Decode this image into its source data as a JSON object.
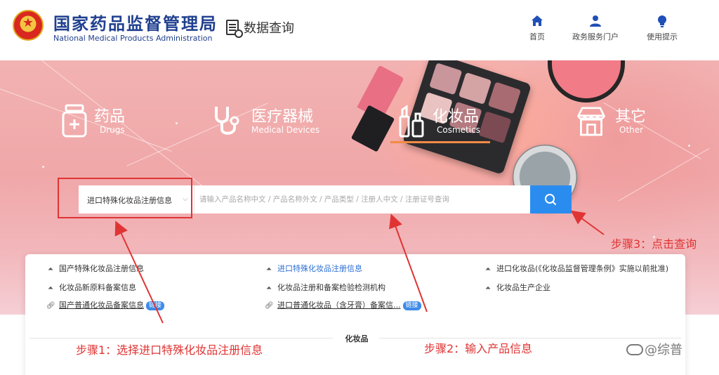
{
  "header": {
    "org_name_cn": "国家药品监督管理局",
    "org_name_en": "National Medical Products Administration",
    "data_query_label": "数据查询",
    "nav": [
      {
        "label": "首页",
        "icon": "home-icon"
      },
      {
        "label": "政务服务门户",
        "icon": "user-icon"
      },
      {
        "label": "使用提示",
        "icon": "lightbulb-icon"
      }
    ]
  },
  "categories": [
    {
      "cn": "药品",
      "en": "Drugs",
      "icon": "pill-bottle-icon"
    },
    {
      "cn": "医疗器械",
      "en": "Medical Devices",
      "icon": "stethoscope-icon"
    },
    {
      "cn": "化妆品",
      "en": "Cosmetics",
      "icon": "cosmetics-icon"
    },
    {
      "cn": "其它",
      "en": "Other",
      "icon": "store-icon"
    }
  ],
  "active_category": "化妆品",
  "search": {
    "selected_type": "进口特殊化妆品注册信息",
    "placeholder": "请输入产品名称中文 / 产品名称外文 / 产品类型 / 注册人中文 / 注册证号查询",
    "value": "",
    "button_icon": "search-icon"
  },
  "links": {
    "col1": [
      {
        "text": "国产特殊化妆品注册信息",
        "icon": "upload-icon"
      },
      {
        "text": "化妆品新原料备案信息",
        "icon": "upload-icon"
      },
      {
        "text": "国产普通化妆品备案信息",
        "icon": "link-icon",
        "tag": "链接"
      }
    ],
    "col2": [
      {
        "text": "进口特殊化妆品注册信息",
        "icon": "upload-icon"
      },
      {
        "text": "化妆品注册和备案检验检测机构",
        "icon": "upload-icon"
      },
      {
        "text": "进口普通化妆品（含牙膏）备案信...",
        "icon": "link-icon",
        "tag": "链接"
      }
    ],
    "col3": [
      {
        "text": "进口化妆品(《化妆品监督管理条例》实施以前批准)",
        "icon": "upload-icon"
      },
      {
        "text": "化妆品生产企业",
        "icon": "upload-icon"
      }
    ]
  },
  "section_title": "化妆品",
  "annotations": {
    "step1": "步骤1：选择进口特殊化妆品注册信息",
    "step2": "步骤2：输入产品信息",
    "step3": "步骤3：点击查询"
  },
  "watermark": "@综普",
  "colors": {
    "brand_blue": "#1f3f8f",
    "accent_blue": "#2b8cf0",
    "annotation_red": "#e03434",
    "active_underline": "#f28b45"
  }
}
